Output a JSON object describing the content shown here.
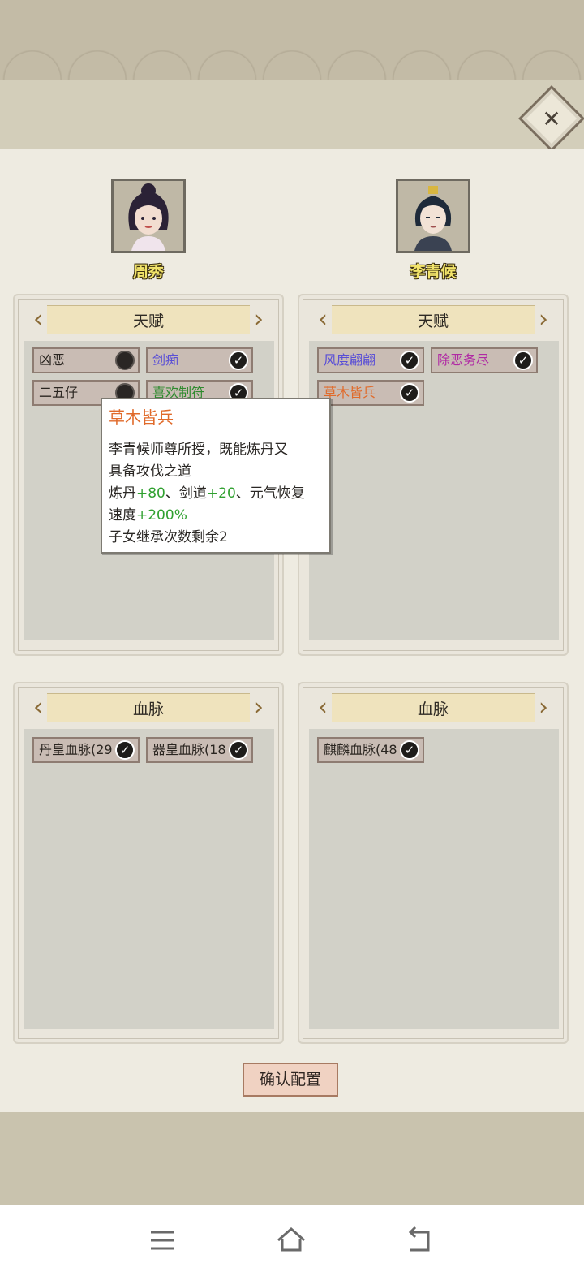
{
  "characters": [
    {
      "name": "周秀"
    },
    {
      "name": "李青候"
    }
  ],
  "panels": {
    "left_talent": {
      "title": "天赋",
      "traits": [
        {
          "label": "凶恶",
          "color": "#2a2520",
          "checked": false
        },
        {
          "label": "剑痴",
          "color": "#5a4fd6",
          "checked": true
        },
        {
          "label": "二五仔",
          "color": "#2a2520",
          "checked": false
        },
        {
          "label": "喜欢制符",
          "color": "#2e8a2e",
          "checked": true
        }
      ]
    },
    "right_talent": {
      "title": "天赋",
      "traits": [
        {
          "label": "风度翩翩",
          "color": "#5a4fd6",
          "checked": true
        },
        {
          "label": "除恶务尽",
          "color": "#b02aa4",
          "checked": true
        },
        {
          "label": "草木皆兵",
          "color": "#e06a2a",
          "checked": true
        }
      ]
    },
    "left_bloodline": {
      "title": "血脉",
      "traits": [
        {
          "label": "丹皇血脉(29",
          "color": "#2a2520",
          "checked": true
        },
        {
          "label": "器皇血脉(18",
          "color": "#2a2520",
          "checked": true
        }
      ]
    },
    "right_bloodline": {
      "title": "血脉",
      "traits": [
        {
          "label": "麒麟血脉(48",
          "color": "#2a2520",
          "checked": true
        }
      ]
    }
  },
  "tooltip": {
    "title": "草木皆兵",
    "desc1": "李青候师尊所授，既能炼丹又",
    "desc2": "具备攻伐之道",
    "s1": "炼丹",
    "v1": "+80",
    "s2": "、剑道",
    "v2": "+20",
    "s3": "、元气恢复",
    "s4": "速度",
    "v4": "+200%",
    "inherit": "子女继承次数剩余2"
  },
  "confirm_label": "确认配置",
  "close_glyph": "✕",
  "check_glyph": "✓",
  "arrow_left": "‹",
  "arrow_right": "›",
  "nav": [
    "menu-icon",
    "home-icon",
    "back-icon"
  ]
}
